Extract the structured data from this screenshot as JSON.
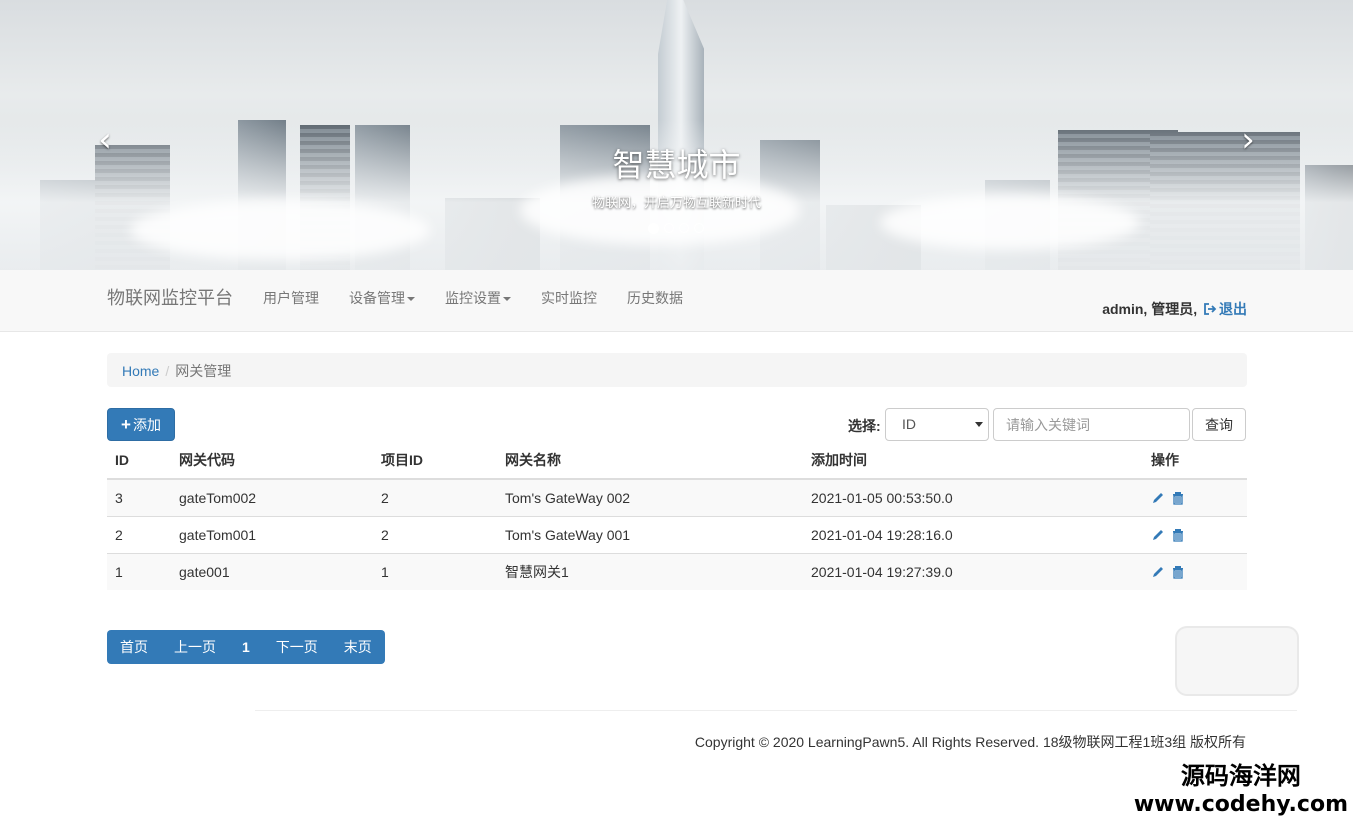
{
  "carousel": {
    "title": "智慧城市",
    "subtitle": "物联网，开启万物互联新时代",
    "slide_count": 4,
    "active_slide": 1,
    "prev_icon": "chevron-left-icon",
    "next_icon": "chevron-right-icon"
  },
  "navbar": {
    "brand": "物联网监控平台",
    "items": [
      {
        "label": "用户管理",
        "dropdown": false
      },
      {
        "label": "设备管理",
        "dropdown": true
      },
      {
        "label": "监控设置",
        "dropdown": true
      },
      {
        "label": "实时监控",
        "dropdown": false
      },
      {
        "label": "历史数据",
        "dropdown": false
      }
    ],
    "user": "admin, 管理员,",
    "logout": "退出",
    "logout_icon": "logout-icon"
  },
  "breadcrumb": {
    "home": "Home",
    "separator": "/",
    "current": "网关管理"
  },
  "toolbar": {
    "add_label": "添加",
    "select_label": "选择:",
    "select_value": "ID",
    "search_placeholder": "请输入关键词",
    "query_label": "查询"
  },
  "table": {
    "headers": [
      "ID",
      "网关代码",
      "项目ID",
      "网关名称",
      "添加时间",
      "操作"
    ],
    "rows": [
      [
        "3",
        "gateTom002",
        "2",
        "Tom's GateWay 002",
        "2021-01-05 00:53:50.0"
      ],
      [
        "2",
        "gateTom001",
        "2",
        "Tom's GateWay 001",
        "2021-01-04 19:28:16.0"
      ],
      [
        "1",
        "gate001",
        "1",
        "智慧网关1",
        "2021-01-04 19:27:39.0"
      ]
    ],
    "op_icons": [
      "pencil-icon",
      "trash-icon"
    ]
  },
  "pagination": {
    "first": "首页",
    "prev": "上一页",
    "current": "1",
    "next": "下一页",
    "last": "末页"
  },
  "footer": {
    "copyright": "Copyright © 2020 LearningPawn5. All Rights Reserved. 18级物联网工程1班3组 版权所有"
  },
  "watermark": {
    "line1": "源码海洋网",
    "line2": "www.codehy.com"
  },
  "colors": {
    "primary": "#337ab7",
    "navbar_bg": "#f8f8f8",
    "breadcrumb_bg": "#f5f5f5",
    "stripe": "#f9f9f9"
  }
}
